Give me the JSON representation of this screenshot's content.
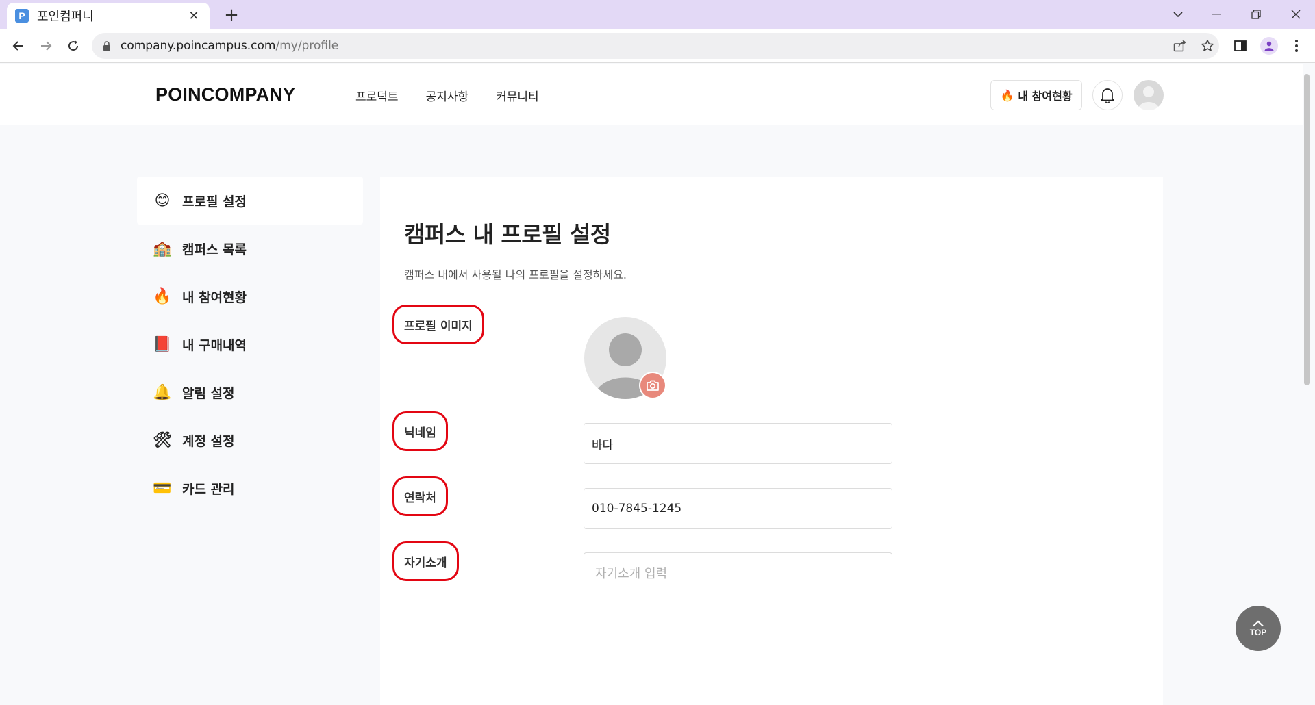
{
  "browser": {
    "tab_favicon": "P",
    "tab_title": "포인컴퍼니",
    "url_domain": "company.poincampus.com",
    "url_path": "/my/profile"
  },
  "header": {
    "logo": "POINCOMPANY",
    "nav": [
      "프로덕트",
      "공지사항",
      "커뮤니티"
    ],
    "participation_button": "내 참여현황"
  },
  "sidebar": {
    "items": [
      {
        "icon": "smiley-icon",
        "label": "프로필 설정",
        "active": true
      },
      {
        "icon": "school-building-icon",
        "label": "캠퍼스 목록"
      },
      {
        "icon": "fire-icon",
        "label": "내 참여현황"
      },
      {
        "icon": "red-book-icon",
        "label": "내 구매내역"
      },
      {
        "icon": "bell-icon",
        "label": "알림 설정"
      },
      {
        "icon": "hammer-wrench-icon",
        "label": "계정 설정"
      },
      {
        "icon": "credit-card-icon",
        "label": "카드 관리"
      }
    ]
  },
  "main": {
    "title": "캠퍼스 내 프로필 설정",
    "description": "캠퍼스 내에서 사용될 나의 프로필을 설정하세요.",
    "fields": {
      "profile_image_label": "프로필 이미지",
      "nickname_label": "닉네임",
      "nickname_value": "바다",
      "phone_label": "연락처",
      "phone_value": "010-7845-1245",
      "bio_label": "자기소개",
      "bio_placeholder": "자기소개 입력"
    }
  },
  "top_button": "TOP",
  "colors": {
    "tabbar": "#e3d9f6",
    "highlight_outline": "#e30613",
    "camera_button": "#e8897c",
    "top_button": "#6e6e6e"
  }
}
